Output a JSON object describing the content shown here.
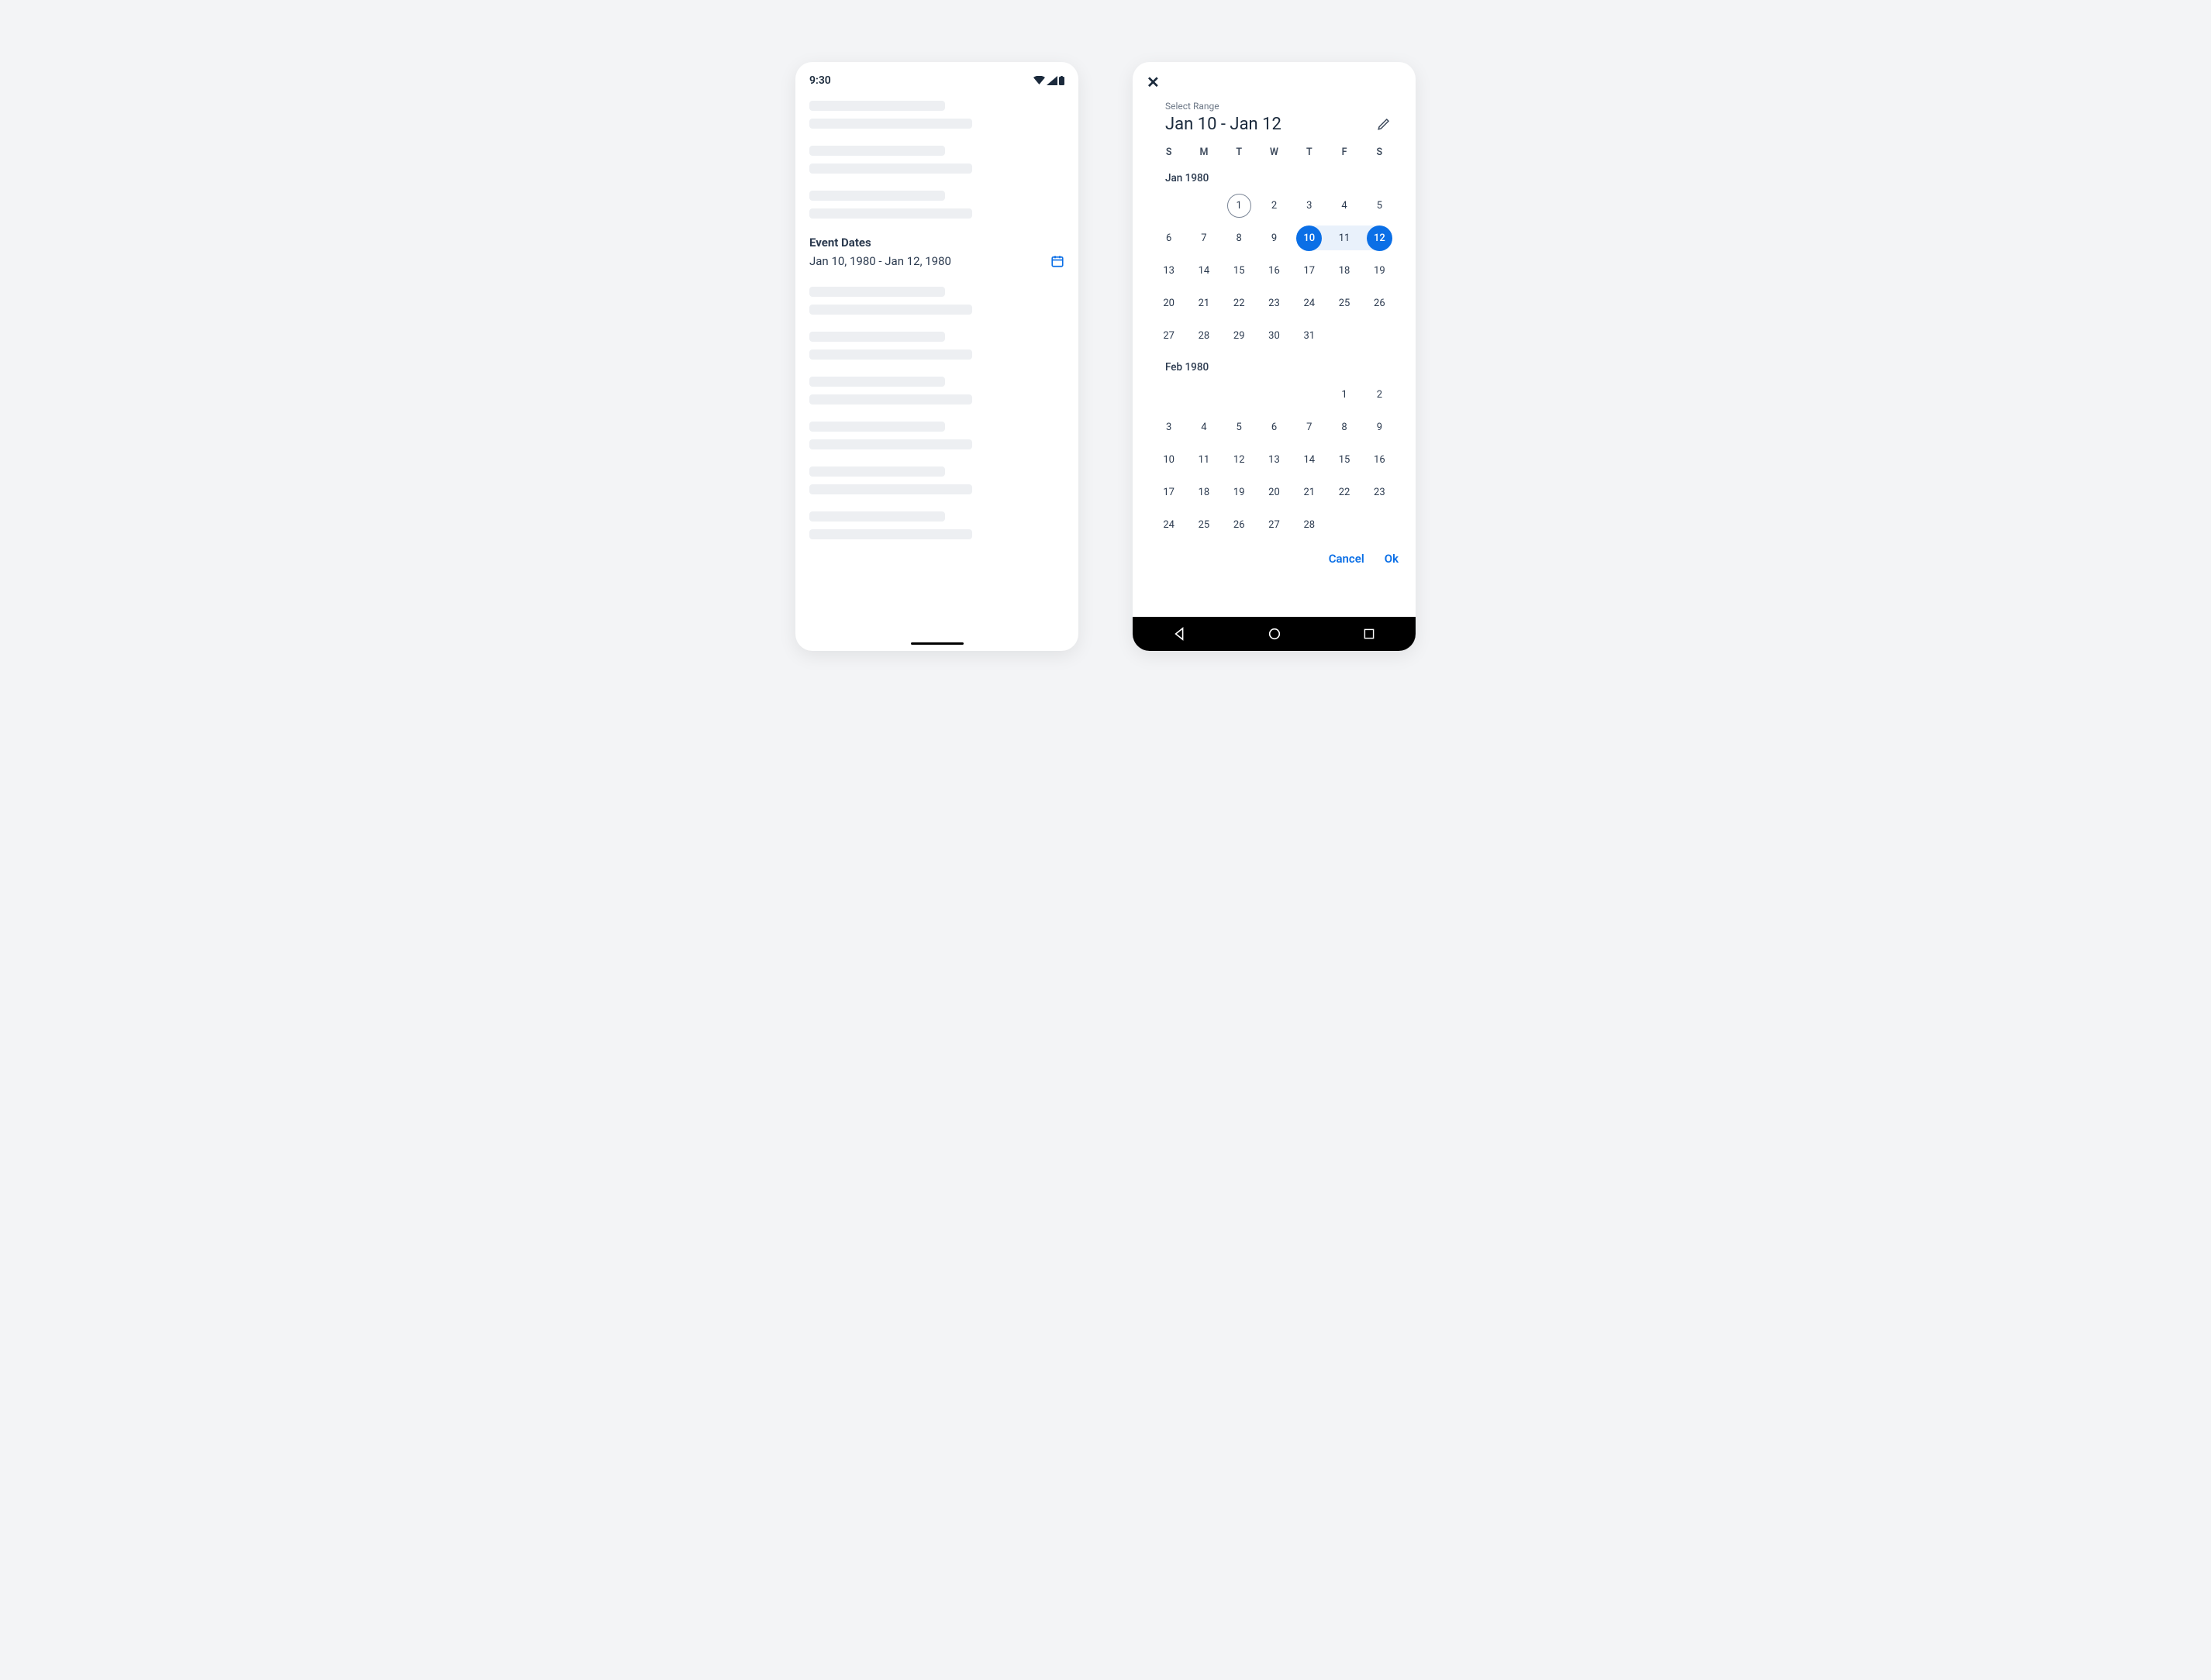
{
  "status": {
    "time": "9:30"
  },
  "event": {
    "label": "Event Dates",
    "value": "Jan 10, 1980 - Jan 12, 1980"
  },
  "picker": {
    "select_range_label": "Select Range",
    "selected_range": "Jan 10 - Jan 12",
    "weekdays": [
      "S",
      "M",
      "T",
      "W",
      "T",
      "F",
      "S"
    ],
    "months": [
      {
        "label": "Jan 1980",
        "offset": 2,
        "days": 31,
        "today": 1,
        "sel_start": 10,
        "sel_end": 12
      },
      {
        "label": "Feb 1980",
        "offset": 5,
        "days": 28
      }
    ],
    "actions": {
      "cancel": "Cancel",
      "ok": "Ok"
    }
  }
}
